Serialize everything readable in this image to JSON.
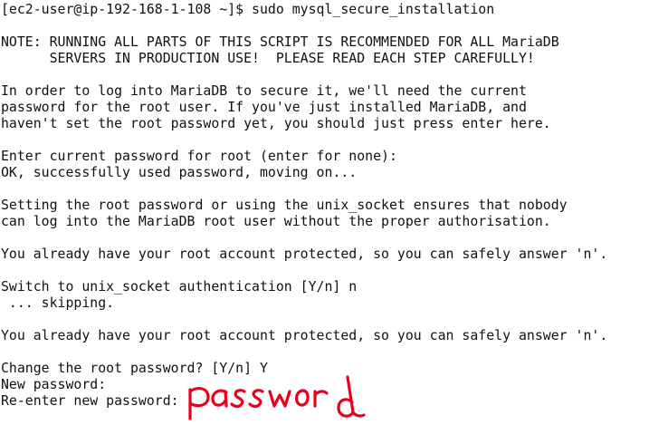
{
  "terminal": {
    "lines": [
      "[ec2-user@ip-192-168-1-108 ~]$ sudo mysql_secure_installation",
      "",
      "NOTE: RUNNING ALL PARTS OF THIS SCRIPT IS RECOMMENDED FOR ALL MariaDB",
      "      SERVERS IN PRODUCTION USE!  PLEASE READ EACH STEP CAREFULLY!",
      "",
      "In order to log into MariaDB to secure it, we'll need the current",
      "password for the root user. If you've just installed MariaDB, and",
      "haven't set the root password yet, you should just press enter here.",
      "",
      "Enter current password for root (enter for none):",
      "OK, successfully used password, moving on...",
      "",
      "Setting the root password or using the unix_socket ensures that nobody",
      "can log into the MariaDB root user without the proper authorisation.",
      "",
      "You already have your root account protected, so you can safely answer 'n'.",
      "",
      "Switch to unix_socket authentication [Y/n] n",
      " ... skipping.",
      "",
      "You already have your root account protected, so you can safely answer 'n'.",
      "",
      "Change the root password? [Y/n] Y",
      "New password:",
      "Re-enter new password:"
    ]
  },
  "annotation": {
    "text": "password",
    "color": "#e8001c"
  }
}
